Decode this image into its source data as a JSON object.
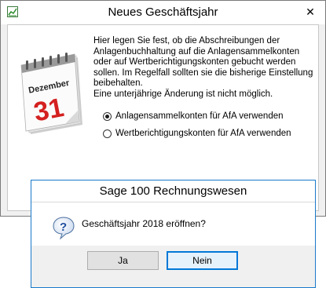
{
  "main_window": {
    "title": "Neues Geschäftsjahr",
    "close_glyph": "✕",
    "calendar": {
      "month": "Dezember",
      "day": "31"
    },
    "description_lines": [
      "Hier legen Sie fest, ob die Abschreibungen der",
      "Anlagenbuchhaltung auf die Anlagensammelkonten",
      "oder auf Wertberichtigungskonten gebucht werden",
      "sollen. Im Regelfall sollten sie die bisherige Einstellung",
      "beibehalten.",
      "Eine unterjährige Änderung ist nicht möglich."
    ],
    "options": [
      {
        "label": "Anlagensammelkonten für AfA verwenden",
        "checked": true
      },
      {
        "label": "Wertberichtigungskonten für AfA verwenden",
        "checked": false
      }
    ]
  },
  "dialog": {
    "title": "Sage 100 Rechnungswesen",
    "message": "Geschäftsjahr 2018 eröffnen?",
    "yes_label": "Ja",
    "no_label": "Nein"
  },
  "colors": {
    "accent": "#0078d7",
    "dialog_border": "#1979ca",
    "calendar_red": "#d42020"
  }
}
